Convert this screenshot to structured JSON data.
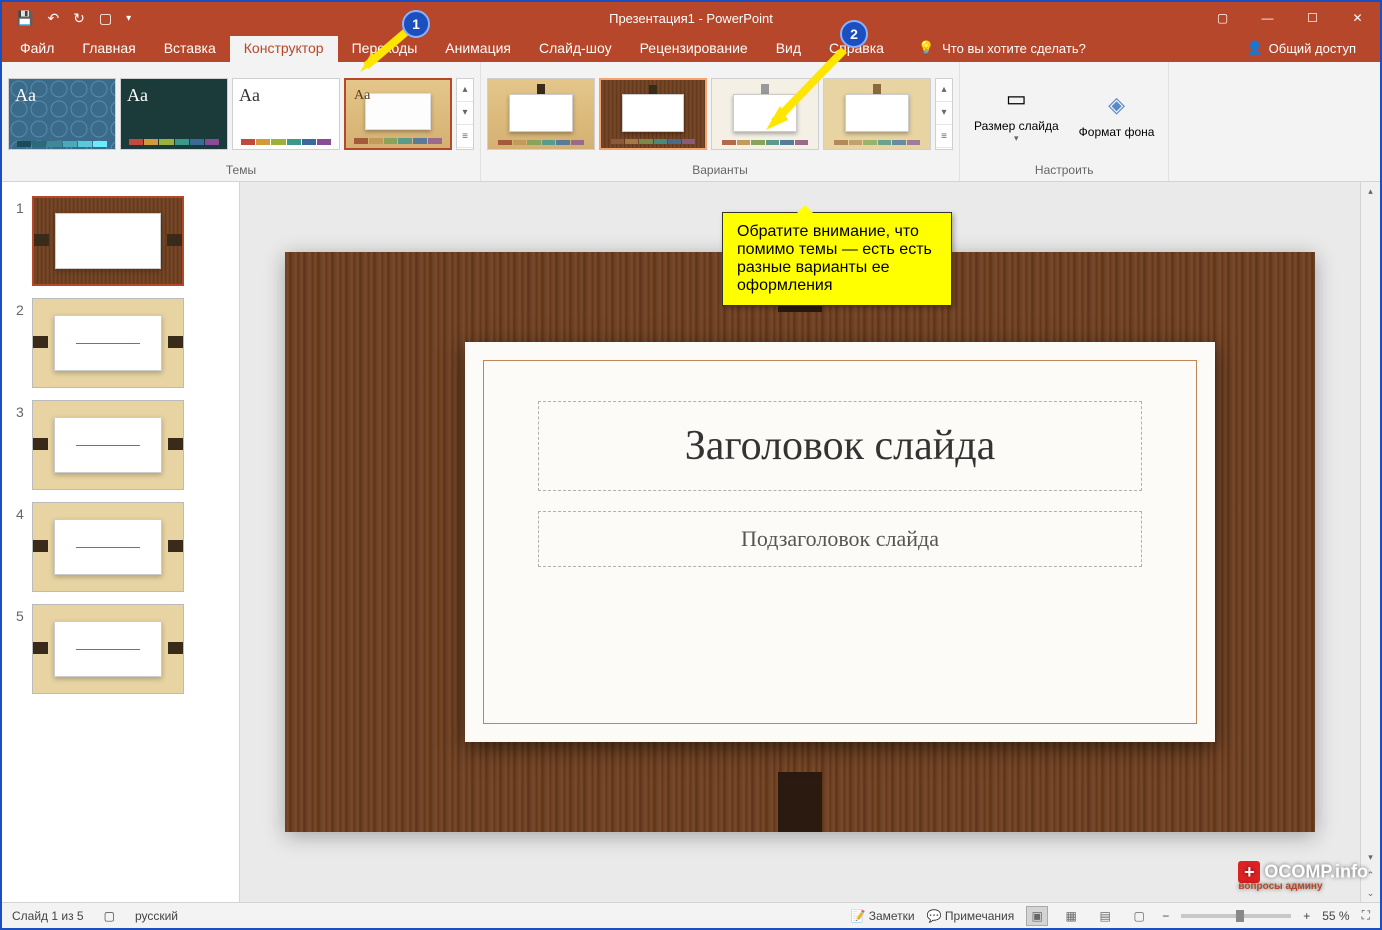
{
  "title": "Презентация1 - PowerPoint",
  "tabs": {
    "file": "Файл",
    "home": "Главная",
    "insert": "Вставка",
    "design": "Конструктор",
    "transitions": "Переходы",
    "animations": "Анимация",
    "slideshow": "Слайд-шоу",
    "review": "Рецензирование",
    "view": "Вид",
    "help": "Справка"
  },
  "tellme": "Что вы хотите сделать?",
  "share": "Общий доступ",
  "ribbon": {
    "themes_label": "Темы",
    "variants_label": "Варианты",
    "customize_label": "Настроить",
    "slide_size": "Размер слайда",
    "format_bg": "Формат фона"
  },
  "slide": {
    "title_placeholder": "Заголовок слайда",
    "subtitle_placeholder": "Подзаголовок слайда"
  },
  "thumbs": [
    "1",
    "2",
    "3",
    "4",
    "5"
  ],
  "status": {
    "slide": "Слайд 1 из 5",
    "lang": "русский",
    "notes": "Заметки",
    "comments": "Примечания",
    "zoom": "55 %"
  },
  "annotations": {
    "badge1": "1",
    "badge2": "2",
    "callout": "Обратите внимание, что помимо темы — есть есть разные варианты ее оформления"
  },
  "watermark": {
    "main": "OCOMP.info",
    "sub": "вопросы админу"
  }
}
